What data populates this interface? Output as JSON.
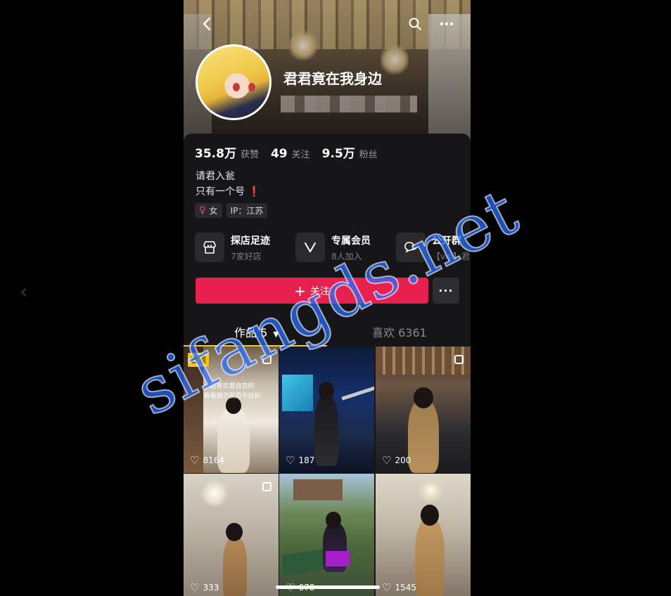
{
  "profile": {
    "nickname": "君君竟在我身边",
    "stats": [
      {
        "num": "35.8万",
        "label": "获赞"
      },
      {
        "num": "49",
        "label": "关注"
      },
      {
        "num": "9.5万",
        "label": "粉丝"
      }
    ],
    "bio_line1": "请君入瓮",
    "bio_line2": "只有一个号",
    "bio_excl": "❗",
    "tags": [
      {
        "label": "女",
        "icon": "female-gender-icon"
      },
      {
        "label": "IP：江苏",
        "icon": ""
      }
    ]
  },
  "services": [
    {
      "title": "探店足迹",
      "sub": "7家好店",
      "icon": "shop-icon"
    },
    {
      "title": "专属会员",
      "sub": "8人加入",
      "icon": "vip-v-icon"
    },
    {
      "title": "公开群",
      "sub": "【vip】君",
      "icon": "chat-group-icon"
    }
  ],
  "actions": {
    "follow_label": "关注",
    "plus": "+",
    "more_dots": "···"
  },
  "tabs": {
    "works": "作品 5",
    "likes": "喜欢 6361"
  },
  "grid": [
    {
      "likes": "8164",
      "pinned": "置顶",
      "caption": "超喜欢君自恋的\n看看镜子就忍不住拍",
      "multi": true
    },
    {
      "likes": "187",
      "multi": false
    },
    {
      "likes": "200",
      "multi": true
    },
    {
      "likes": "333",
      "multi": true
    },
    {
      "likes": "678",
      "multi": false
    },
    {
      "likes": "1545",
      "multi": false
    }
  ],
  "watermark": "sifangds.net",
  "colors": {
    "accent_red": "#e8204d",
    "tab_underline": "#f5c518",
    "watermark": "#286eff"
  }
}
